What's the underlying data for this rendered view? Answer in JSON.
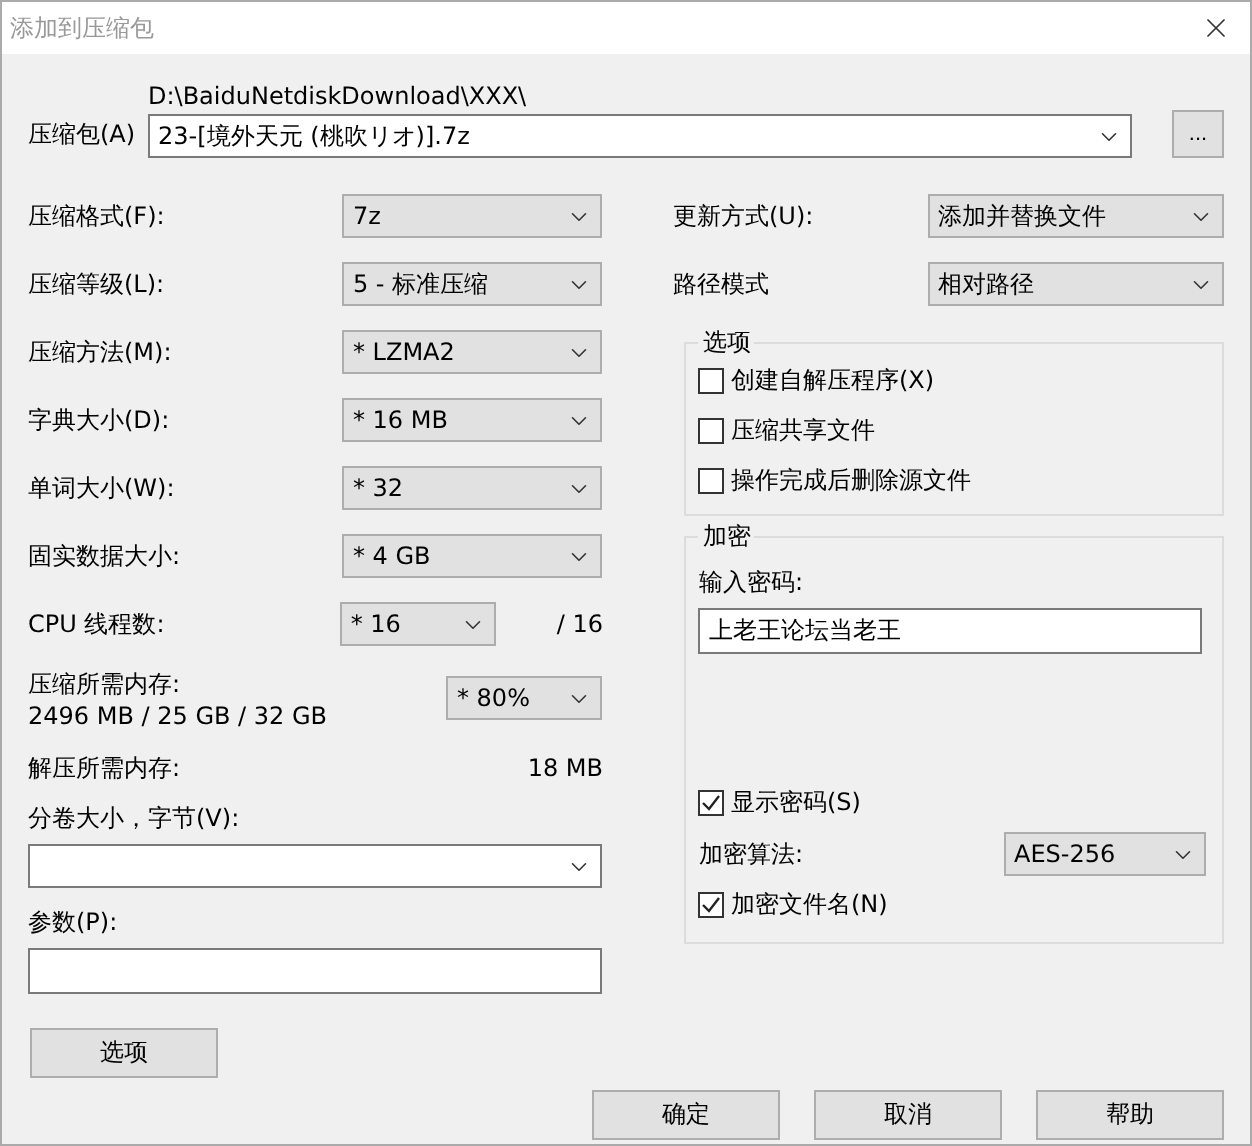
{
  "window": {
    "title": "添加到压缩包"
  },
  "archive": {
    "label": "压缩包(A)",
    "path": "D:\\BaiduNetdiskDownload\\XXX\\",
    "value": "23-[境外天元 (桃吹リオ)].7z",
    "browse": "..."
  },
  "settings": [
    {
      "kind": "select",
      "label": "压缩格式(F):",
      "value": "7z"
    },
    {
      "kind": "select",
      "label": "压缩等级(L):",
      "value": "5 - 标准压缩"
    },
    {
      "kind": "select",
      "label": "压缩方法(M):",
      "value": "* LZMA2"
    },
    {
      "kind": "select",
      "label": "字典大小(D):",
      "value": "* 16 MB"
    },
    {
      "kind": "select",
      "label": "单词大小(W):",
      "value": "* 32"
    },
    {
      "kind": "select",
      "label": "固实数据大小:",
      "value": "* 4 GB"
    },
    {
      "kind": "threads",
      "label": "CPU 线程数:",
      "value": "* 16",
      "note": "/ 16"
    },
    {
      "kind": "memory",
      "label": "压缩所需内存:",
      "detail": "2496 MB / 25 GB / 32 GB",
      "value": "* 80%"
    },
    {
      "kind": "readout",
      "label": "解压所需内存:",
      "note": "18 MB"
    }
  ],
  "volume": {
    "label": "分卷大小，字节(V):"
  },
  "parameters": {
    "label": "参数(P):"
  },
  "options_button": "选项",
  "modes": [
    {
      "label": "更新方式(U):",
      "value": "添加并替换文件"
    },
    {
      "label": "路径模式",
      "value": "相对路径"
    }
  ],
  "options_group": {
    "title": "选项",
    "items": [
      {
        "label": "创建自解压程序(X)",
        "checked": false
      },
      {
        "label": "压缩共享文件",
        "checked": false
      },
      {
        "label": "操作完成后删除源文件",
        "checked": false
      }
    ]
  },
  "encryption": {
    "title": "加密",
    "password_label": "输入密码:",
    "password": "上老王论坛当老王",
    "show_password": {
      "label": "显示密码(S)",
      "checked": true
    },
    "method_label": "加密算法:",
    "method": "AES-256",
    "encrypt_names": {
      "label": "加密文件名(N)",
      "checked": true
    }
  },
  "buttons": [
    "确定",
    "取消",
    "帮助"
  ]
}
